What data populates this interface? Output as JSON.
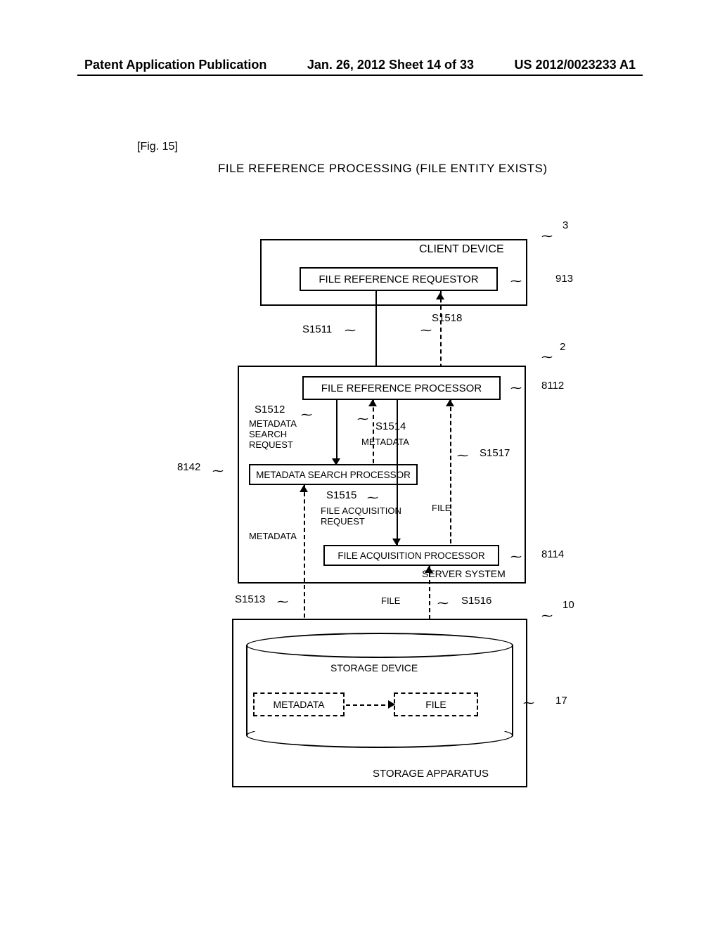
{
  "header": {
    "left": "Patent Application Publication",
    "center": "Jan. 26, 2012  Sheet 14 of 33",
    "right": "US 2012/0023233 A1"
  },
  "figure_label": "[Fig. 15]",
  "title": "FILE REFERENCE PROCESSING (FILE ENTITY EXISTS)",
  "client": {
    "title": "CLIENT DEVICE",
    "file_ref_requestor": "FILE REFERENCE REQUESTOR",
    "ref_num": "3",
    "req_ref": "913"
  },
  "steps": {
    "s1511": "S1511",
    "s1512": "S1512",
    "s1513": "S1513",
    "s1514": "S1514",
    "s1515": "S1515",
    "s1516": "S1516",
    "s1517": "S1517",
    "s1518": "S1518"
  },
  "server": {
    "ref_num": "2",
    "file_ref_processor": "FILE REFERENCE PROCESSOR",
    "file_ref_proc_ref": "8112",
    "meta_search_request": "METADATA\nSEARCH\nREQUEST",
    "metadata_label": "METADATA",
    "meta_search_processor": "METADATA SEARCH PROCESSOR",
    "meta_search_proc_ref": "8142",
    "file_acq_request": "FILE ACQUISITION\nREQUEST",
    "file_label": "FILE",
    "file_acq_processor": "FILE ACQUISITION PROCESSOR",
    "file_acq_proc_ref": "8114",
    "system_label": "SERVER SYSTEM",
    "metadata_leftlabel": "METADATA"
  },
  "storage": {
    "ref_num": "10",
    "device_label": "STORAGE DEVICE",
    "metadata_cell": "METADATA",
    "file_cell": "FILE",
    "apparatus_label": "STORAGE APPARATUS",
    "device_ref": "17",
    "file_arrow_label": "FILE"
  }
}
